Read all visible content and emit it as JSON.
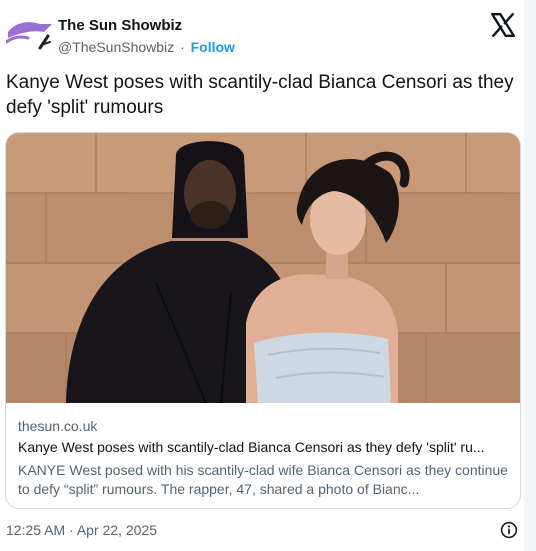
{
  "author": {
    "display_name": "The Sun Showbiz",
    "handle": "@TheSunShowbiz",
    "separator": "·",
    "follow_label": "Follow"
  },
  "tweet": {
    "text": "Kanye West poses with scantily-clad Bianca Censori as they defy 'split' rumours",
    "timestamp": "12:25 AM · Apr 22, 2025"
  },
  "card": {
    "domain": "thesun.co.uk",
    "title": "Kanye West poses with scantily-clad Bianca Censori as they defy 'split' ru...",
    "description": "KANYE West posed with his scantily-clad wife Bianca Censori as they continue to defy “split” rumours. The rapper, 47, shared a photo of Bianc..."
  },
  "icons": {
    "avatar": "sun-showbiz-logo",
    "brand": "x-logo",
    "info": "info-icon"
  },
  "colors": {
    "accent": "#1d9bf0",
    "avatar_purple": "#9a6fd6",
    "text": "#0f1419",
    "muted": "#536471",
    "border": "#cfd9de"
  }
}
